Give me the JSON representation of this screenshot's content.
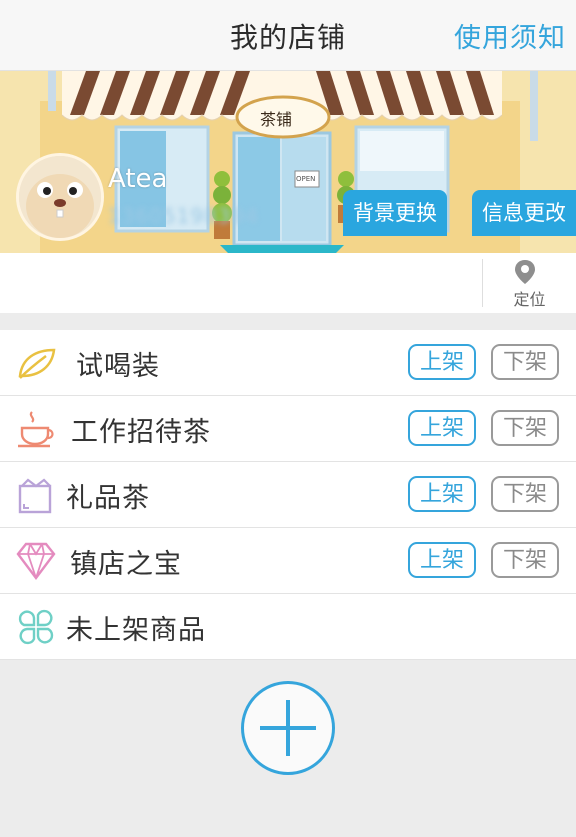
{
  "header": {
    "title": "我的店铺",
    "notice_link": "使用须知"
  },
  "banner": {
    "shop_sign": "茶铺",
    "door_sign": "OPEN",
    "shop_name": "Atea",
    "phone_blurred": "13605198394",
    "change_background_label": "背景更换",
    "edit_info_label": "信息更改"
  },
  "location": {
    "label": "定位"
  },
  "categories": [
    {
      "label": "试喝装",
      "icon": "leaf-icon",
      "on_shelf": "上架",
      "off_shelf": "下架"
    },
    {
      "label": "工作招待茶",
      "icon": "teacup-icon",
      "on_shelf": "上架",
      "off_shelf": "下架"
    },
    {
      "label": "礼品茶",
      "icon": "gift-box-icon",
      "on_shelf": "上架",
      "off_shelf": "下架"
    },
    {
      "label": "镇店之宝",
      "icon": "diamond-icon",
      "on_shelf": "上架",
      "off_shelf": "下架"
    },
    {
      "label": "未上架商品",
      "icon": "clover-icon"
    }
  ],
  "colors": {
    "accent": "#35a5dc",
    "button_fill": "#2aa6df",
    "gray_border": "#9a9a9a",
    "background": "#ececec"
  },
  "add_button": {
    "icon": "plus-icon"
  }
}
